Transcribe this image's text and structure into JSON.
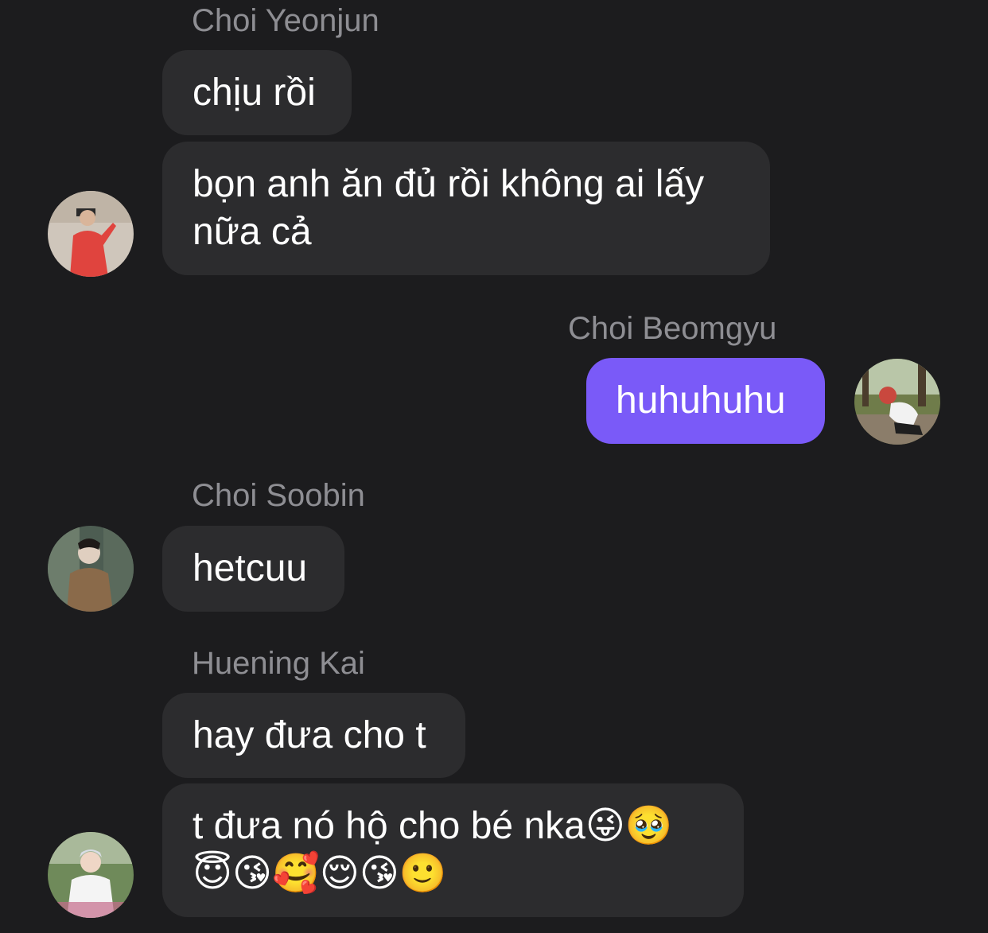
{
  "colors": {
    "background": "#1c1c1e",
    "incoming_bubble": "#2c2c2e",
    "outgoing_bubble": "#7a5af8",
    "sender_name": "#8e8e93",
    "text": "#ffffff"
  },
  "conversation": {
    "groups": [
      {
        "sender": "Choi Yeonjun",
        "direction": "incoming",
        "messages": [
          {
            "lines": [
              "chịu rồi"
            ]
          },
          {
            "lines": [
              "bọn anh ăn đủ rồi không ai lấy",
              "nữa cả"
            ]
          }
        ],
        "avatar": "avatar-yeonjun"
      },
      {
        "sender": "Choi Beomgyu",
        "direction": "outgoing",
        "messages": [
          {
            "lines": [
              "huhuhuhu"
            ]
          }
        ],
        "avatar": "avatar-beomgyu"
      },
      {
        "sender": "Choi Soobin",
        "direction": "incoming",
        "messages": [
          {
            "lines": [
              "hetcuu"
            ]
          }
        ],
        "avatar": "avatar-soobin"
      },
      {
        "sender": "Huening Kai",
        "direction": "incoming",
        "messages": [
          {
            "lines": [
              "hay đưa cho t"
            ]
          },
          {
            "lines": [
              "t đưa nó hộ cho bé nka😜🥹",
              "😇😘🥰😌😘🙂"
            ]
          }
        ],
        "avatar": "avatar-hueningkai"
      }
    ]
  }
}
